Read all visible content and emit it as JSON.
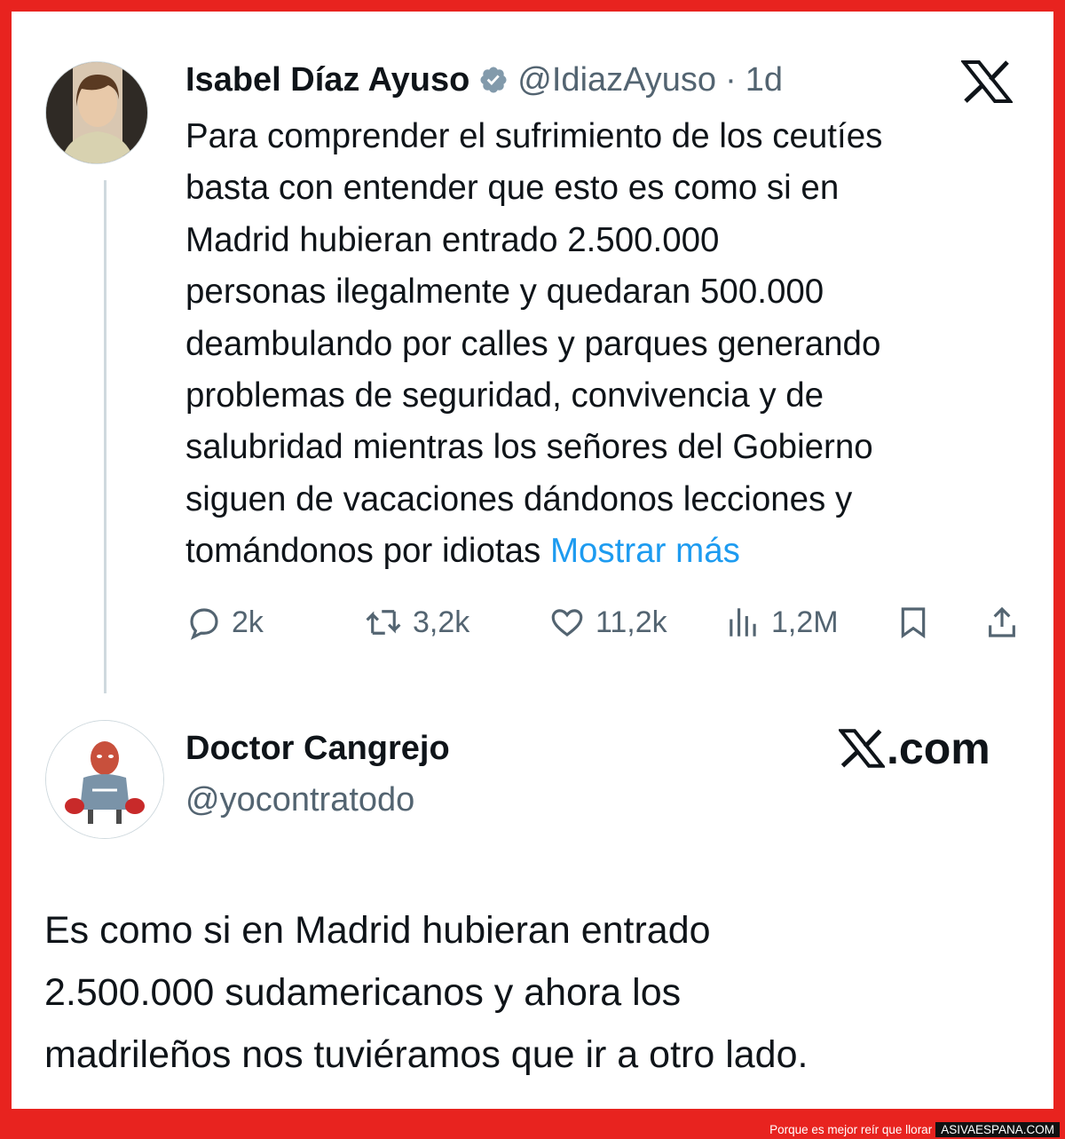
{
  "tweet": {
    "author_name": "Isabel Díaz Ayuso",
    "handle": "@IdiazAyuso",
    "separator": "·",
    "time": "1d",
    "text_lines": [
      "Para comprender el sufrimiento de los ceutíes",
      "basta con entender que esto es como si en",
      "Madrid hubieran entrado 2.500.000",
      "personas ilegalmente y quedaran 500.000",
      "deambulando por calles y parques generando",
      "problemas de seguridad, convivencia y de",
      "salubridad mientras los señores del Gobierno",
      "siguen de vacaciones dándonos lecciones y",
      "tomándonos por idiotas"
    ],
    "show_more": "Mostrar más",
    "actions": {
      "replies": "2k",
      "reposts": "3,2k",
      "likes": "11,2k",
      "views": "1,2M"
    }
  },
  "reply": {
    "author_name": "Doctor Cangrejo",
    "handle": "@yocontratodo",
    "domain_suffix": ".com",
    "text_lines": [
      "Es como si en Madrid hubieran entrado",
      "2.500.000 sudamericanos y ahora los",
      "madrileños nos tuviéramos que ir a otro lado."
    ]
  },
  "footer": {
    "tagline": "Porque es mejor reír que llorar",
    "brand": "ASIVAESPANA.COM"
  },
  "colors": {
    "frame": "#e8231f",
    "link": "#1d9bf0",
    "verified": "#829aab",
    "muted": "#536471",
    "text": "#0f1419"
  },
  "icons": {
    "verified": "verified-badge-icon",
    "x_logo": "x-logo-icon",
    "reply": "reply-bubble-icon",
    "repost": "repost-icon",
    "like": "heart-icon",
    "views": "views-bar-chart-icon",
    "bookmark": "bookmark-icon",
    "share": "share-icon"
  }
}
